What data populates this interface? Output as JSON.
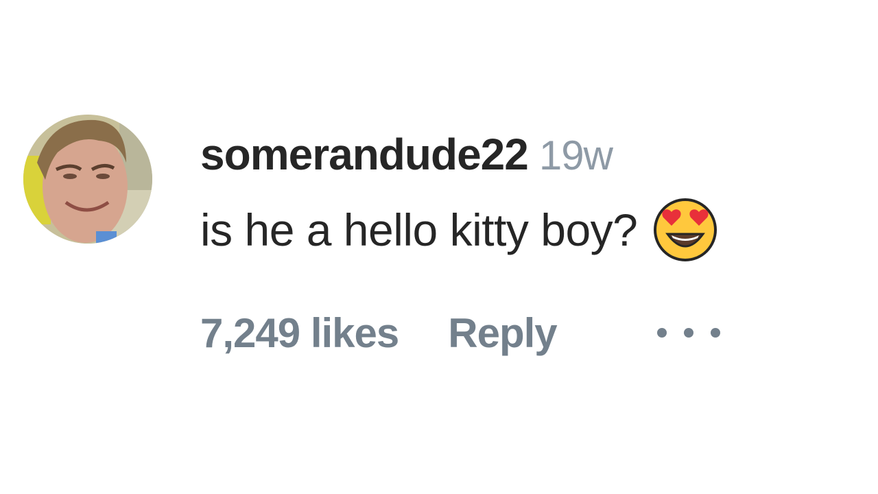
{
  "comment": {
    "username": "somerandude22",
    "timestamp": "19w",
    "text": "is he a hello kitty boy?",
    "emoji": "smiling-face-with-heart-eyes",
    "likes": "7,249 likes",
    "reply_label": "Reply",
    "more_icon": "more-options-icon"
  },
  "colors": {
    "primary_text": "#262626",
    "secondary_text": "#73808c",
    "timestamp": "#8e9aa6",
    "emoji_face": "#ffc83d",
    "emoji_heart": "#e8303a"
  }
}
